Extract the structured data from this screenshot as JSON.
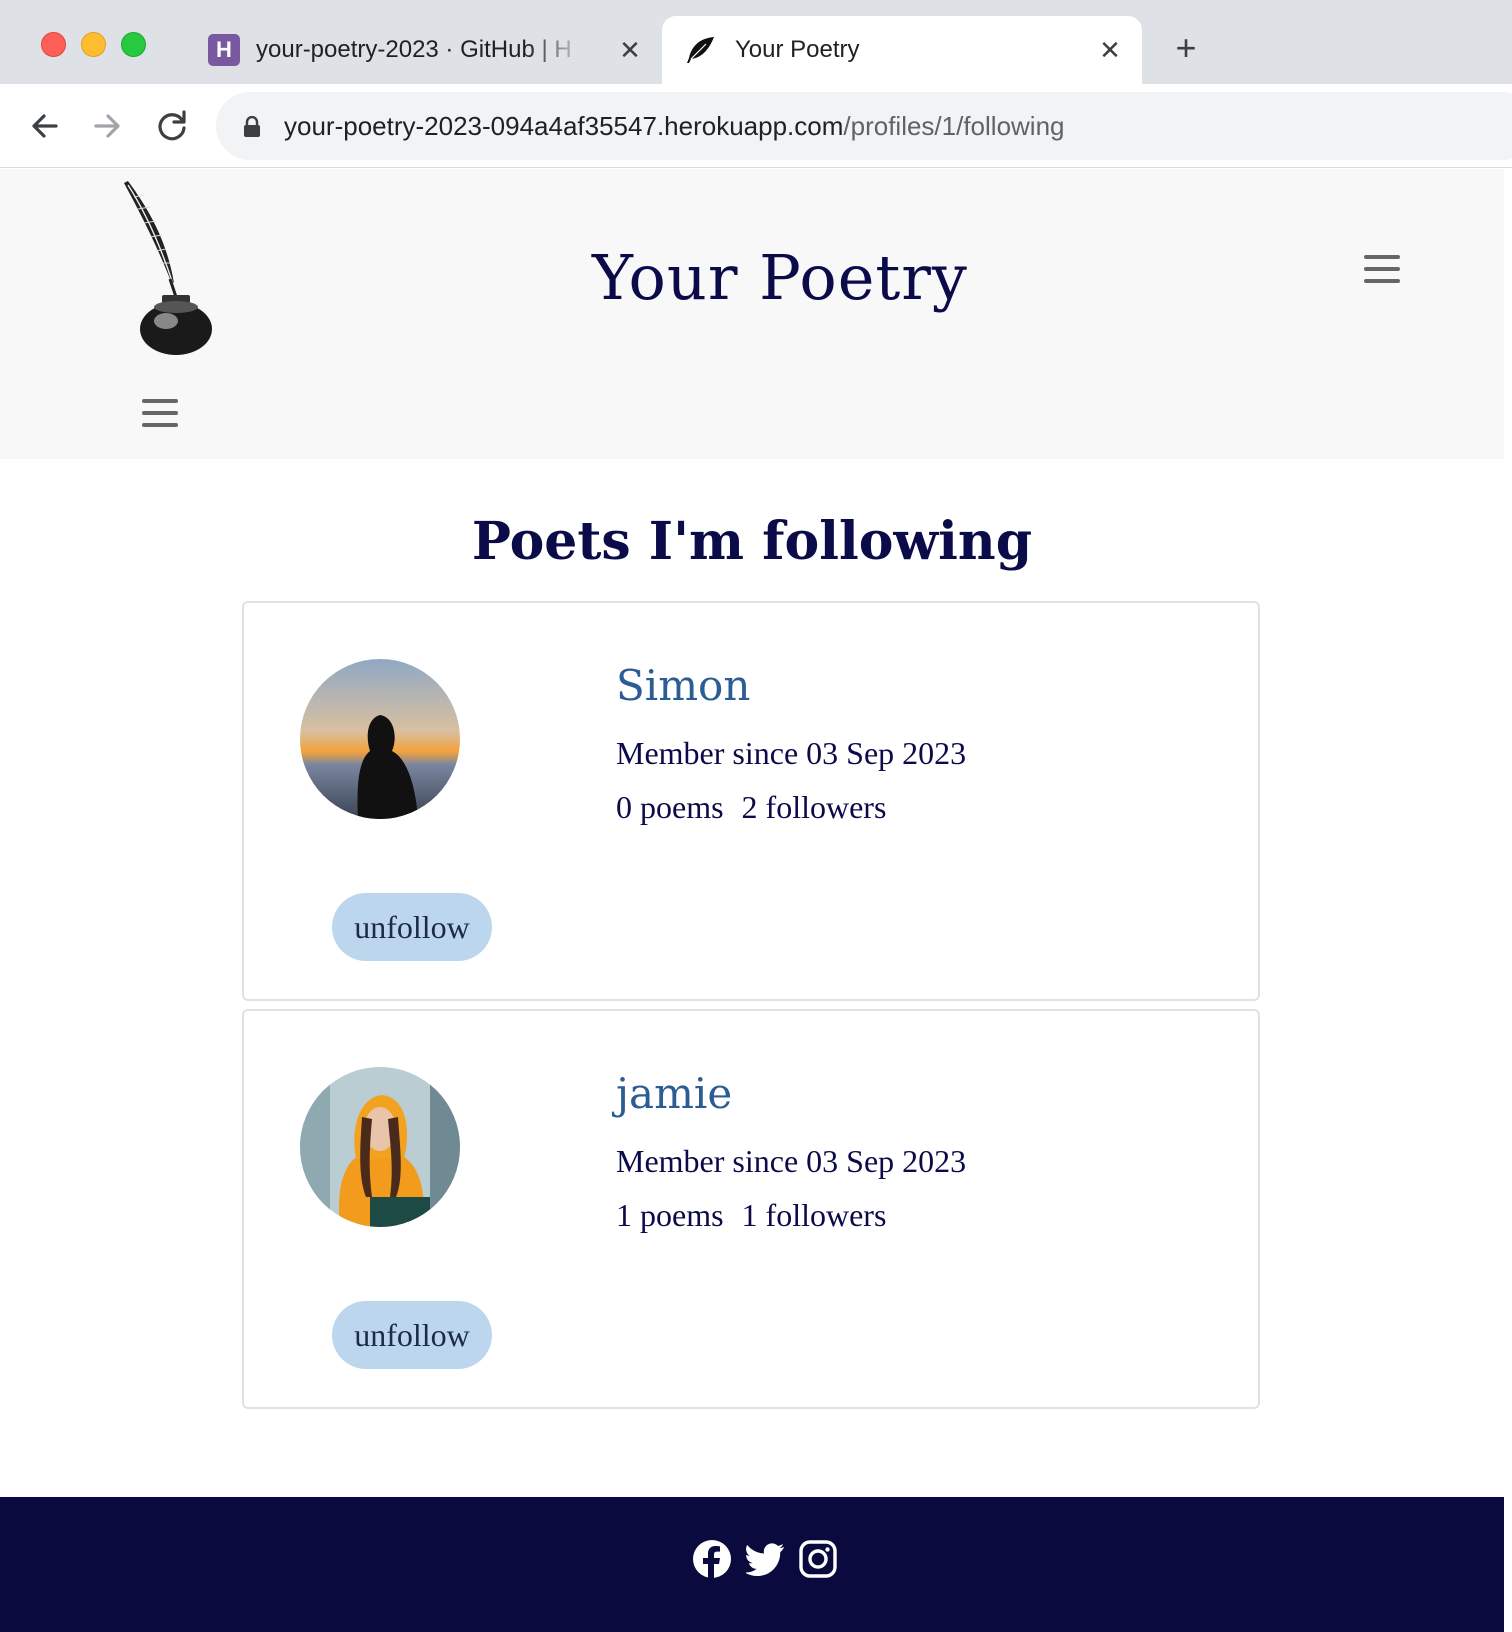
{
  "browser": {
    "tabs": [
      {
        "title": "your-poetry-2023 · GitHub | H",
        "favicon": "heroku-icon",
        "active": false
      },
      {
        "title": "Your Poetry",
        "favicon": "feather-icon",
        "active": true
      }
    ],
    "address": {
      "host": "your-poetry-2023-094a4af35547.herokuapp.com",
      "path": "/profiles/1/following"
    }
  },
  "site": {
    "title": "Your Poetry"
  },
  "page": {
    "title": "Poets I'm following"
  },
  "poets": [
    {
      "name": "Simon",
      "member_since": "Member since 03 Sep 2023",
      "poems": "0 poems",
      "followers": "2 followers",
      "button": "unfollow"
    },
    {
      "name": "jamie",
      "member_since": "Member since 03 Sep 2023",
      "poems": "1 poems",
      "followers": "1 followers",
      "button": "unfollow"
    }
  ],
  "footer": {
    "social_icons": [
      "facebook-icon",
      "twitter-icon",
      "instagram-icon"
    ]
  },
  "colors": {
    "brand_navy": "#0b0b4a",
    "link_blue": "#2c5c94",
    "button_bg": "#bcd6ee",
    "footer_bg": "#0b0a3f"
  }
}
